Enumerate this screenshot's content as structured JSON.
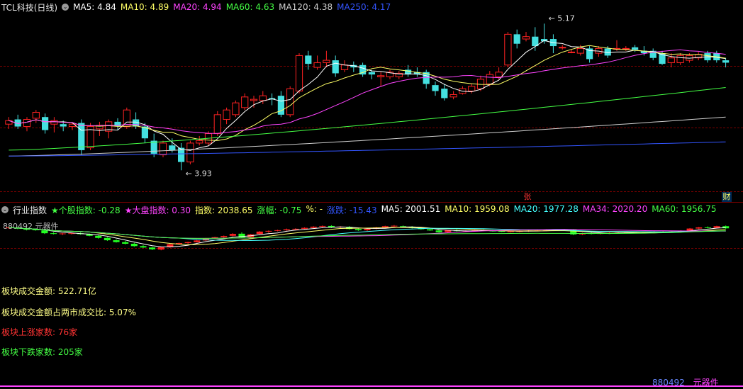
{
  "main_header": {
    "title": "TCL科技(日线)",
    "items": [
      {
        "label": "MA5: 4.84",
        "color": "#ffffff"
      },
      {
        "label": "MA10: 4.89",
        "color": "#ffff66"
      },
      {
        "label": "MA20: 4.94",
        "color": "#ff44ff"
      },
      {
        "label": "MA60: 4.63",
        "color": "#44ff44"
      },
      {
        "label": "MA120: 4.38",
        "color": "#cfcfcf"
      },
      {
        "label": "MA250: 4.17",
        "color": "#3355ff"
      }
    ]
  },
  "sub_header": {
    "title": "行业指数",
    "items": [
      {
        "label": "★个股指数: -0.28",
        "color": "#44ff44"
      },
      {
        "label": "★大盘指数: 0.30",
        "color": "#ff44ff"
      },
      {
        "label": "指数: 2038.65",
        "color": "#ffff66"
      },
      {
        "label": "涨幅: -0.75",
        "color": "#44ff44"
      },
      {
        "label": "%: -",
        "color": "#ffff66"
      },
      {
        "label": "涨跌: -15.43",
        "color": "#3355ff"
      },
      {
        "label": "MA5: 2001.51",
        "color": "#ffffff"
      },
      {
        "label": "MA10: 1959.08",
        "color": "#ffff66"
      },
      {
        "label": "MA20: 1977.28",
        "color": "#44ffff"
      },
      {
        "label": "MA34: 2020.20",
        "color": "#ff44ff"
      },
      {
        "label": "MA60: 1956.75",
        "color": "#44ff44"
      }
    ]
  },
  "sector_tag": "880492 元器件",
  "bottom_tag": {
    "code": "880492",
    "name": "元器件"
  },
  "info_lines": [
    {
      "text": "板块成交金额: 522.71亿",
      "color": "#ffff88"
    },
    {
      "text": "板块成交金额占两市成交比: 5.07%",
      "color": "#ffff88"
    },
    {
      "text": "板块上涨家数: 76家",
      "color": "#ff3333"
    },
    {
      "text": "板块下跌家数: 205家",
      "color": "#44ff44"
    }
  ],
  "badges": {
    "zhang": "张",
    "cai": "财"
  },
  "colors": {
    "up": "#ff2222",
    "down": "#44e0e0",
    "ind_up": "#ff2222",
    "ind_down": "#22ff22",
    "grid": "#7a0000"
  },
  "chart_data": [
    {
      "type": "candlestick",
      "title": "TCL科技(日线)",
      "annotations": [
        {
          "label": "5.17",
          "kind": "high",
          "value": 5.17
        },
        {
          "label": "3.93",
          "kind": "low",
          "value": 3.93
        }
      ],
      "ylim": [
        3.8,
        5.25
      ],
      "candles": [
        {
          "o": 4.32,
          "h": 4.38,
          "l": 4.28,
          "c": 4.35
        },
        {
          "o": 4.36,
          "h": 4.4,
          "l": 4.28,
          "c": 4.3
        },
        {
          "o": 4.3,
          "h": 4.38,
          "l": 4.26,
          "c": 4.36
        },
        {
          "o": 4.37,
          "h": 4.44,
          "l": 4.33,
          "c": 4.42
        },
        {
          "o": 4.38,
          "h": 4.41,
          "l": 4.24,
          "c": 4.27
        },
        {
          "o": 4.32,
          "h": 4.38,
          "l": 4.25,
          "c": 4.35
        },
        {
          "o": 4.32,
          "h": 4.35,
          "l": 4.26,
          "c": 4.3
        },
        {
          "o": 4.3,
          "h": 4.33,
          "l": 4.27,
          "c": 4.32
        },
        {
          "o": 4.33,
          "h": 4.36,
          "l": 4.06,
          "c": 4.1
        },
        {
          "o": 4.12,
          "h": 4.33,
          "l": 4.1,
          "c": 4.3
        },
        {
          "o": 4.28,
          "h": 4.34,
          "l": 4.22,
          "c": 4.31
        },
        {
          "o": 4.26,
          "h": 4.36,
          "l": 4.2,
          "c": 4.34
        },
        {
          "o": 4.34,
          "h": 4.37,
          "l": 4.27,
          "c": 4.3
        },
        {
          "o": 4.3,
          "h": 4.46,
          "l": 4.28,
          "c": 4.44
        },
        {
          "o": 4.36,
          "h": 4.42,
          "l": 4.28,
          "c": 4.3
        },
        {
          "o": 4.3,
          "h": 4.33,
          "l": 4.16,
          "c": 4.2
        },
        {
          "o": 4.18,
          "h": 4.24,
          "l": 4.04,
          "c": 4.07
        },
        {
          "o": 4.06,
          "h": 4.18,
          "l": 4.04,
          "c": 4.16
        },
        {
          "o": 4.14,
          "h": 4.2,
          "l": 4.08,
          "c": 4.1
        },
        {
          "o": 4.12,
          "h": 4.16,
          "l": 3.93,
          "c": 4.0
        },
        {
          "o": 4.0,
          "h": 4.18,
          "l": 3.98,
          "c": 4.16
        },
        {
          "o": 4.16,
          "h": 4.22,
          "l": 4.14,
          "c": 4.18
        },
        {
          "o": 4.16,
          "h": 4.26,
          "l": 4.14,
          "c": 4.24
        },
        {
          "o": 4.24,
          "h": 4.43,
          "l": 4.22,
          "c": 4.4
        },
        {
          "o": 4.36,
          "h": 4.46,
          "l": 4.32,
          "c": 4.44
        },
        {
          "o": 4.4,
          "h": 4.52,
          "l": 4.38,
          "c": 4.5
        },
        {
          "o": 4.46,
          "h": 4.58,
          "l": 4.44,
          "c": 4.55
        },
        {
          "o": 4.52,
          "h": 4.56,
          "l": 4.46,
          "c": 4.53
        },
        {
          "o": 4.52,
          "h": 4.6,
          "l": 4.49,
          "c": 4.56
        },
        {
          "o": 4.54,
          "h": 4.58,
          "l": 4.48,
          "c": 4.53
        },
        {
          "o": 4.56,
          "h": 4.6,
          "l": 4.38,
          "c": 4.4
        },
        {
          "o": 4.4,
          "h": 4.64,
          "l": 4.38,
          "c": 4.62
        },
        {
          "o": 4.6,
          "h": 4.92,
          "l": 4.58,
          "c": 4.9
        },
        {
          "o": 4.9,
          "h": 4.94,
          "l": 4.78,
          "c": 4.83
        },
        {
          "o": 4.8,
          "h": 4.9,
          "l": 4.78,
          "c": 4.84
        },
        {
          "o": 4.84,
          "h": 4.94,
          "l": 4.8,
          "c": 4.86
        },
        {
          "o": 4.86,
          "h": 4.9,
          "l": 4.72,
          "c": 4.75
        },
        {
          "o": 4.78,
          "h": 4.86,
          "l": 4.76,
          "c": 4.82
        },
        {
          "o": 4.82,
          "h": 4.85,
          "l": 4.76,
          "c": 4.8
        },
        {
          "o": 4.82,
          "h": 4.84,
          "l": 4.72,
          "c": 4.74
        },
        {
          "o": 4.76,
          "h": 4.78,
          "l": 4.7,
          "c": 4.74
        },
        {
          "o": 4.72,
          "h": 4.76,
          "l": 4.64,
          "c": 4.73
        },
        {
          "o": 4.72,
          "h": 4.78,
          "l": 4.7,
          "c": 4.76
        },
        {
          "o": 4.72,
          "h": 4.77,
          "l": 4.7,
          "c": 4.75
        },
        {
          "o": 4.78,
          "h": 4.82,
          "l": 4.72,
          "c": 4.74
        },
        {
          "o": 4.76,
          "h": 4.8,
          "l": 4.72,
          "c": 4.74
        },
        {
          "o": 4.76,
          "h": 4.78,
          "l": 4.62,
          "c": 4.66
        },
        {
          "o": 4.65,
          "h": 4.68,
          "l": 4.56,
          "c": 4.6
        },
        {
          "o": 4.62,
          "h": 4.66,
          "l": 4.52,
          "c": 4.54
        },
        {
          "o": 4.55,
          "h": 4.6,
          "l": 4.53,
          "c": 4.57
        },
        {
          "o": 4.58,
          "h": 4.64,
          "l": 4.57,
          "c": 4.62
        },
        {
          "o": 4.6,
          "h": 4.66,
          "l": 4.58,
          "c": 4.64
        },
        {
          "o": 4.62,
          "h": 4.73,
          "l": 4.6,
          "c": 4.7
        },
        {
          "o": 4.66,
          "h": 4.77,
          "l": 4.64,
          "c": 4.74
        },
        {
          "o": 4.72,
          "h": 4.8,
          "l": 4.7,
          "c": 4.76
        },
        {
          "o": 4.82,
          "h": 5.1,
          "l": 4.8,
          "c": 5.08
        },
        {
          "o": 5.08,
          "h": 5.12,
          "l": 4.96,
          "c": 5.0
        },
        {
          "o": 5.04,
          "h": 5.1,
          "l": 5.02,
          "c": 5.06
        },
        {
          "o": 5.06,
          "h": 5.14,
          "l": 4.94,
          "c": 4.98
        },
        {
          "o": 5.04,
          "h": 5.17,
          "l": 5.0,
          "c": 5.02
        },
        {
          "o": 5.04,
          "h": 5.08,
          "l": 4.92,
          "c": 4.98
        },
        {
          "o": 4.97,
          "h": 4.99,
          "l": 4.95,
          "c": 4.97
        },
        {
          "o": 4.93,
          "h": 4.95,
          "l": 4.92,
          "c": 4.93
        },
        {
          "o": 4.92,
          "h": 4.99,
          "l": 4.9,
          "c": 4.96
        },
        {
          "o": 4.96,
          "h": 4.98,
          "l": 4.84,
          "c": 4.87
        },
        {
          "o": 4.92,
          "h": 4.98,
          "l": 4.89,
          "c": 4.96
        },
        {
          "o": 4.96,
          "h": 4.98,
          "l": 4.88,
          "c": 4.9
        },
        {
          "o": 4.96,
          "h": 5.03,
          "l": 4.94,
          "c": 4.96
        },
        {
          "o": 4.96,
          "h": 4.98,
          "l": 4.94,
          "c": 4.96
        },
        {
          "o": 4.97,
          "h": 4.99,
          "l": 4.93,
          "c": 4.95
        },
        {
          "o": 4.94,
          "h": 4.98,
          "l": 4.9,
          "c": 4.92
        },
        {
          "o": 4.94,
          "h": 4.96,
          "l": 4.86,
          "c": 4.88
        },
        {
          "o": 4.92,
          "h": 4.94,
          "l": 4.82,
          "c": 4.83
        },
        {
          "o": 4.84,
          "h": 4.92,
          "l": 4.8,
          "c": 4.88
        },
        {
          "o": 4.84,
          "h": 4.92,
          "l": 4.82,
          "c": 4.9
        },
        {
          "o": 4.86,
          "h": 4.92,
          "l": 4.84,
          "c": 4.9
        },
        {
          "o": 4.88,
          "h": 4.93,
          "l": 4.86,
          "c": 4.91
        },
        {
          "o": 4.92,
          "h": 4.94,
          "l": 4.84,
          "c": 4.86
        },
        {
          "o": 4.92,
          "h": 4.94,
          "l": 4.84,
          "c": 4.86
        },
        {
          "o": 4.86,
          "h": 4.88,
          "l": 4.8,
          "c": 4.84
        }
      ]
    },
    {
      "type": "candlestick",
      "title": "行业指数",
      "ylim": [
        1700,
        2100
      ],
      "candles": [
        {
          "o": 2040,
          "h": 2050,
          "l": 2034,
          "c": 2045
        },
        {
          "o": 2042,
          "h": 2048,
          "l": 2030,
          "c": 2035
        },
        {
          "o": 2036,
          "h": 2042,
          "l": 2020,
          "c": 2026
        },
        {
          "o": 2028,
          "h": 2034,
          "l": 2018,
          "c": 2022
        },
        {
          "o": 2020,
          "h": 2026,
          "l": 1990,
          "c": 1996
        },
        {
          "o": 1996,
          "h": 2004,
          "l": 1986,
          "c": 1990
        },
        {
          "o": 1990,
          "h": 1998,
          "l": 1980,
          "c": 1994
        },
        {
          "o": 1994,
          "h": 2000,
          "l": 1986,
          "c": 1996
        },
        {
          "o": 1996,
          "h": 2002,
          "l": 1984,
          "c": 1988
        },
        {
          "o": 1988,
          "h": 1994,
          "l": 1970,
          "c": 1974
        },
        {
          "o": 1974,
          "h": 1982,
          "l": 1950,
          "c": 1956
        },
        {
          "o": 1956,
          "h": 1962,
          "l": 1930,
          "c": 1936
        },
        {
          "o": 1936,
          "h": 1944,
          "l": 1916,
          "c": 1920
        },
        {
          "o": 1920,
          "h": 1930,
          "l": 1900,
          "c": 1906
        },
        {
          "o": 1906,
          "h": 1914,
          "l": 1880,
          "c": 1886
        },
        {
          "o": 1886,
          "h": 1894,
          "l": 1870,
          "c": 1874
        },
        {
          "o": 1874,
          "h": 1880,
          "l": 1852,
          "c": 1858
        },
        {
          "o": 1856,
          "h": 1880,
          "l": 1850,
          "c": 1876
        },
        {
          "o": 1876,
          "h": 1906,
          "l": 1872,
          "c": 1902
        },
        {
          "o": 1900,
          "h": 1916,
          "l": 1896,
          "c": 1912
        },
        {
          "o": 1912,
          "h": 1924,
          "l": 1904,
          "c": 1920
        },
        {
          "o": 1920,
          "h": 1938,
          "l": 1916,
          "c": 1934
        },
        {
          "o": 1934,
          "h": 1956,
          "l": 1930,
          "c": 1952
        },
        {
          "o": 1950,
          "h": 1966,
          "l": 1946,
          "c": 1962
        },
        {
          "o": 1962,
          "h": 1976,
          "l": 1956,
          "c": 1972
        },
        {
          "o": 1974,
          "h": 1996,
          "l": 1970,
          "c": 1990
        },
        {
          "o": 1992,
          "h": 2004,
          "l": 1956,
          "c": 1960
        },
        {
          "o": 1962,
          "h": 1990,
          "l": 1958,
          "c": 1986
        },
        {
          "o": 1990,
          "h": 2014,
          "l": 1986,
          "c": 2010
        },
        {
          "o": 2010,
          "h": 2020,
          "l": 2000,
          "c": 2016
        },
        {
          "o": 2016,
          "h": 2026,
          "l": 2012,
          "c": 2022
        },
        {
          "o": 2022,
          "h": 2036,
          "l": 2018,
          "c": 2030
        },
        {
          "o": 2030,
          "h": 2038,
          "l": 2024,
          "c": 2034
        },
        {
          "o": 2034,
          "h": 2046,
          "l": 2030,
          "c": 2042
        },
        {
          "o": 2042,
          "h": 2056,
          "l": 2038,
          "c": 2052
        },
        {
          "o": 2052,
          "h": 2062,
          "l": 2046,
          "c": 2058
        },
        {
          "o": 2058,
          "h": 2064,
          "l": 2040,
          "c": 2046
        },
        {
          "o": 2046,
          "h": 2056,
          "l": 2040,
          "c": 2052
        },
        {
          "o": 2050,
          "h": 2056,
          "l": 2028,
          "c": 2032
        },
        {
          "o": 2032,
          "h": 2040,
          "l": 2016,
          "c": 2022
        },
        {
          "o": 2022,
          "h": 2038,
          "l": 2016,
          "c": 2034
        },
        {
          "o": 2034,
          "h": 2050,
          "l": 2030,
          "c": 2046
        },
        {
          "o": 2046,
          "h": 2060,
          "l": 2040,
          "c": 2056
        },
        {
          "o": 2058,
          "h": 2066,
          "l": 2050,
          "c": 2060
        },
        {
          "o": 2056,
          "h": 2062,
          "l": 2046,
          "c": 2050
        },
        {
          "o": 2050,
          "h": 2056,
          "l": 2036,
          "c": 2040
        },
        {
          "o": 2040,
          "h": 2046,
          "l": 2026,
          "c": 2030
        },
        {
          "o": 2030,
          "h": 2036,
          "l": 2016,
          "c": 2020
        },
        {
          "o": 2020,
          "h": 2026,
          "l": 2000,
          "c": 2004
        },
        {
          "o": 2006,
          "h": 2024,
          "l": 2002,
          "c": 2022
        },
        {
          "o": 2022,
          "h": 2030,
          "l": 2010,
          "c": 2014
        },
        {
          "o": 2014,
          "h": 2022,
          "l": 2008,
          "c": 2018
        },
        {
          "o": 2018,
          "h": 2026,
          "l": 2012,
          "c": 2022
        },
        {
          "o": 2022,
          "h": 2030,
          "l": 2014,
          "c": 2018
        },
        {
          "o": 2018,
          "h": 2024,
          "l": 2010,
          "c": 2014
        },
        {
          "o": 2014,
          "h": 2020,
          "l": 2006,
          "c": 2010
        },
        {
          "o": 2010,
          "h": 2018,
          "l": 2002,
          "c": 2012
        },
        {
          "o": 2012,
          "h": 2020,
          "l": 2004,
          "c": 2014
        },
        {
          "o": 2014,
          "h": 2024,
          "l": 2008,
          "c": 2018
        },
        {
          "o": 2018,
          "h": 2026,
          "l": 2012,
          "c": 2020
        },
        {
          "o": 2020,
          "h": 2028,
          "l": 2014,
          "c": 2022
        },
        {
          "o": 2022,
          "h": 2030,
          "l": 2016,
          "c": 2024
        },
        {
          "o": 2024,
          "h": 2032,
          "l": 2018,
          "c": 2026
        },
        {
          "o": 2024,
          "h": 2030,
          "l": 1980,
          "c": 1986
        },
        {
          "o": 1986,
          "h": 2000,
          "l": 1980,
          "c": 1996
        },
        {
          "o": 1996,
          "h": 2004,
          "l": 1986,
          "c": 1992
        },
        {
          "o": 1992,
          "h": 2000,
          "l": 1986,
          "c": 1996
        },
        {
          "o": 1996,
          "h": 2004,
          "l": 1990,
          "c": 1998
        },
        {
          "o": 1998,
          "h": 2006,
          "l": 1992,
          "c": 2000
        },
        {
          "o": 2000,
          "h": 2008,
          "l": 1994,
          "c": 2002
        },
        {
          "o": 2002,
          "h": 2010,
          "l": 1996,
          "c": 2004
        },
        {
          "o": 2004,
          "h": 2012,
          "l": 1998,
          "c": 2006
        },
        {
          "o": 2006,
          "h": 2014,
          "l": 2000,
          "c": 2008
        },
        {
          "o": 2008,
          "h": 2016,
          "l": 2002,
          "c": 2010
        },
        {
          "o": 2010,
          "h": 2018,
          "l": 2004,
          "c": 2012
        },
        {
          "o": 2012,
          "h": 2022,
          "l": 2006,
          "c": 2018
        },
        {
          "o": 2018,
          "h": 2040,
          "l": 2014,
          "c": 2036
        },
        {
          "o": 2036,
          "h": 2050,
          "l": 2030,
          "c": 2046
        },
        {
          "o": 2046,
          "h": 2054,
          "l": 2036,
          "c": 2042
        },
        {
          "o": 2042,
          "h": 2060,
          "l": 2040,
          "c": 2056
        },
        {
          "o": 2056,
          "h": 2062,
          "l": 2034,
          "c": 2038
        }
      ]
    }
  ]
}
